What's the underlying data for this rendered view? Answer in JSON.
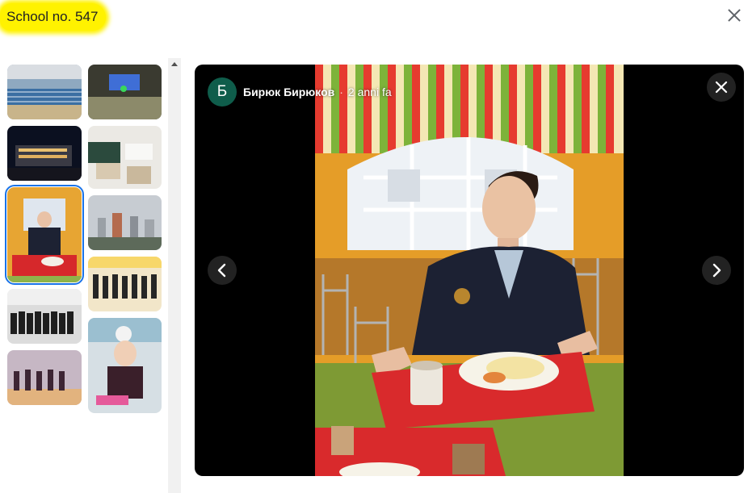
{
  "header": {
    "title": "School no. 547",
    "close_icon": "close-icon",
    "highlight_color": "#fff200"
  },
  "gallery": {
    "thumbnails": [
      {
        "name": "thumb-swimming-pool"
      },
      {
        "name": "thumb-auditorium"
      },
      {
        "name": "thumb-school-night"
      },
      {
        "name": "thumb-classroom"
      },
      {
        "name": "thumb-cafeteria",
        "selected": true
      },
      {
        "name": "thumb-city-view"
      },
      {
        "name": "thumb-dance-group"
      },
      {
        "name": "thumb-class-photo"
      },
      {
        "name": "thumb-gymnastics"
      },
      {
        "name": "thumb-girl-first-day"
      }
    ]
  },
  "viewer": {
    "author": {
      "avatar_letter": "Б",
      "name": "Бирюк Бирюков",
      "separator": "·",
      "time": "2 anni fa",
      "avatar_color": "#0f5d4b"
    },
    "close_icon": "close-icon",
    "prev_icon": "chevron-left-icon",
    "next_icon": "chevron-right-icon"
  }
}
